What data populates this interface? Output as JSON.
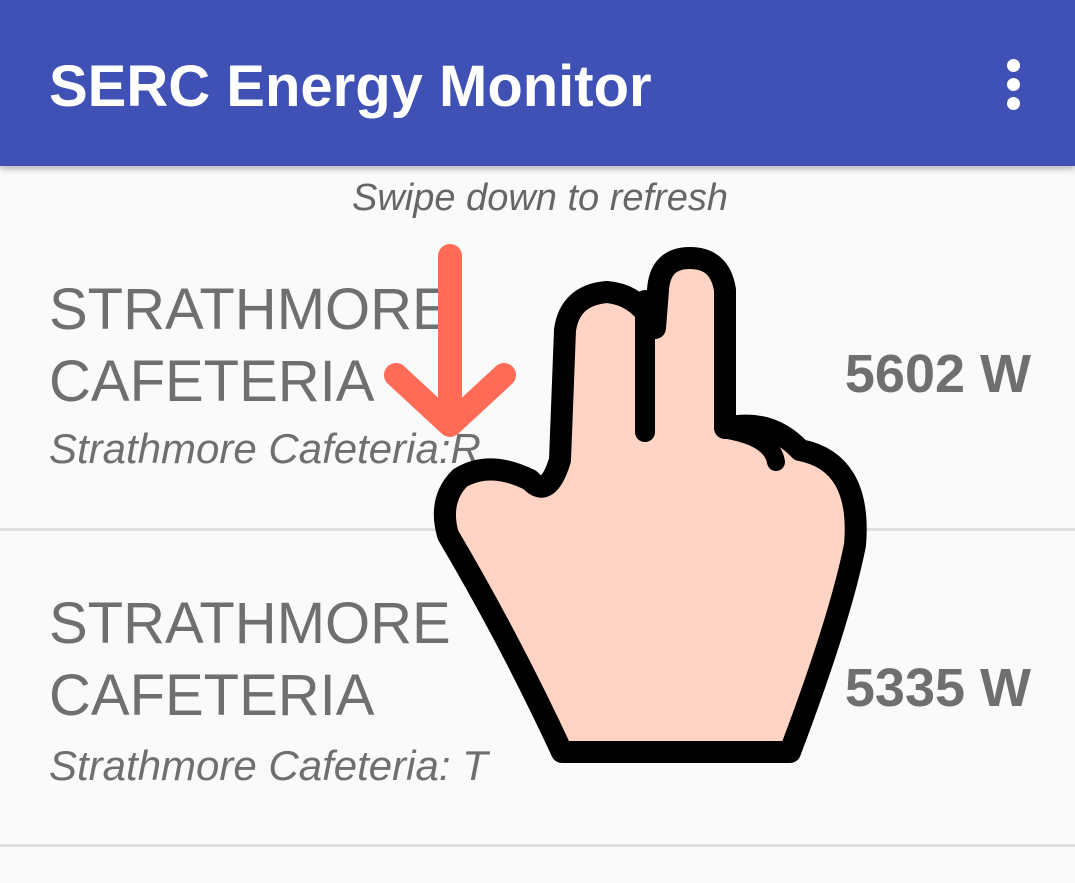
{
  "app_bar": {
    "title": "SERC Energy Monitor",
    "menu_icon": "more-vert-icon",
    "background_color": "#3f51b5"
  },
  "hint": {
    "text": "Swipe down to refresh",
    "gesture_icon": "two-finger-swipe-down-icon",
    "arrow_color": "#ff6b57"
  },
  "list": {
    "items": [
      {
        "title": "STRATHMORE CAFETERIA",
        "subtitle": "Strathmore Cafeteria:R",
        "power": "5602 W"
      },
      {
        "title": "STRATHMORE CAFETERIA",
        "subtitle": "Strathmore Cafeteria: T",
        "power": "5335 W"
      }
    ]
  }
}
